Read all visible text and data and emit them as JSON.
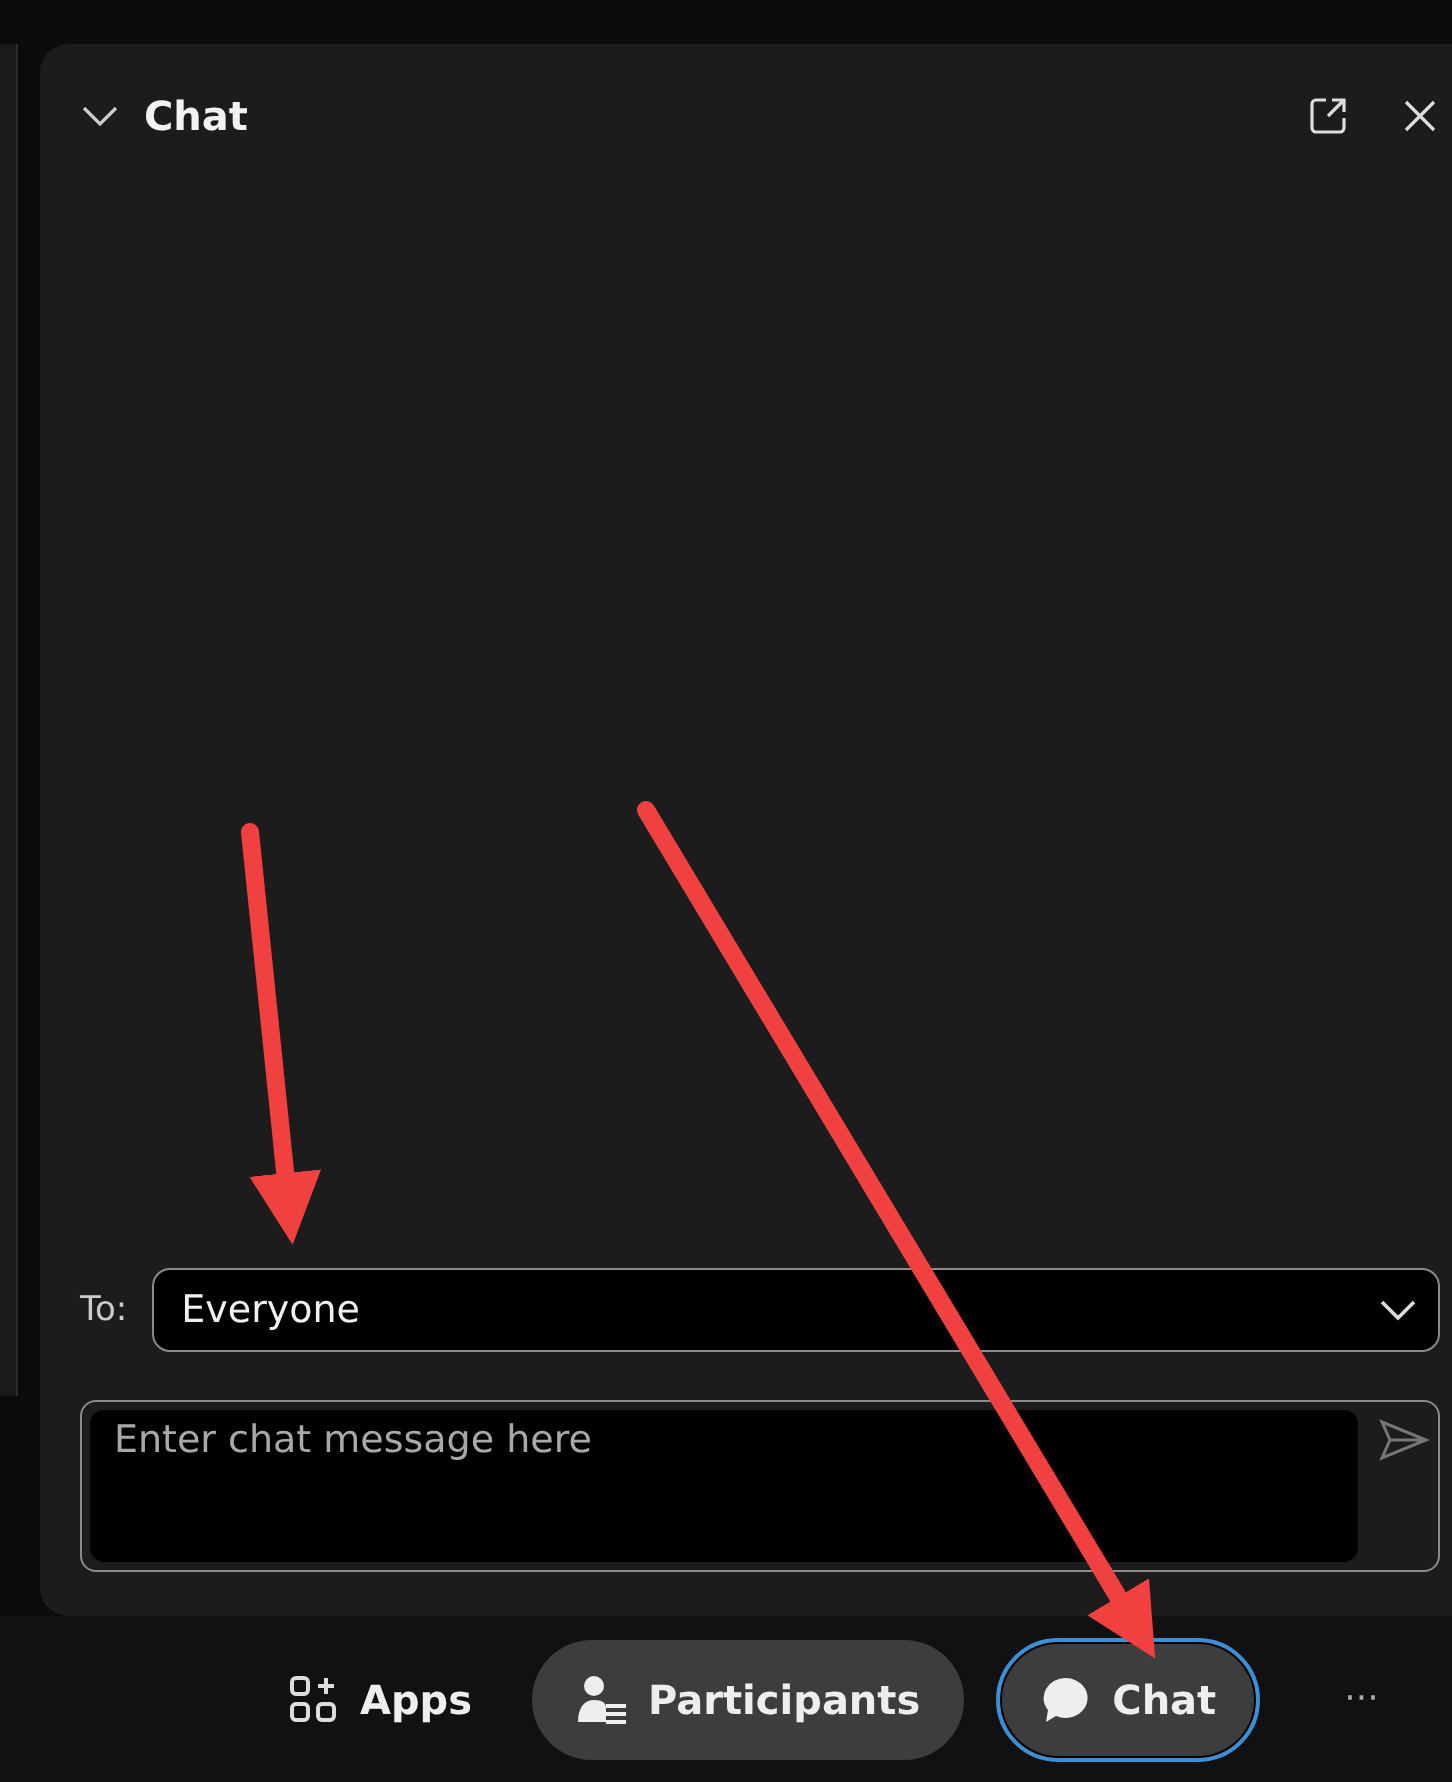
{
  "panel": {
    "title": "Chat",
    "expanded": true
  },
  "recipient": {
    "label": "To:",
    "value": "Everyone"
  },
  "message": {
    "placeholder": "Enter chat message here"
  },
  "toolbar": [
    {
      "label": "Apps",
      "kind": "plain",
      "selected": false
    },
    {
      "label": "Participants",
      "kind": "pill",
      "selected": false
    },
    {
      "label": "Chat",
      "kind": "pill",
      "selected": true
    }
  ],
  "more": "···"
}
